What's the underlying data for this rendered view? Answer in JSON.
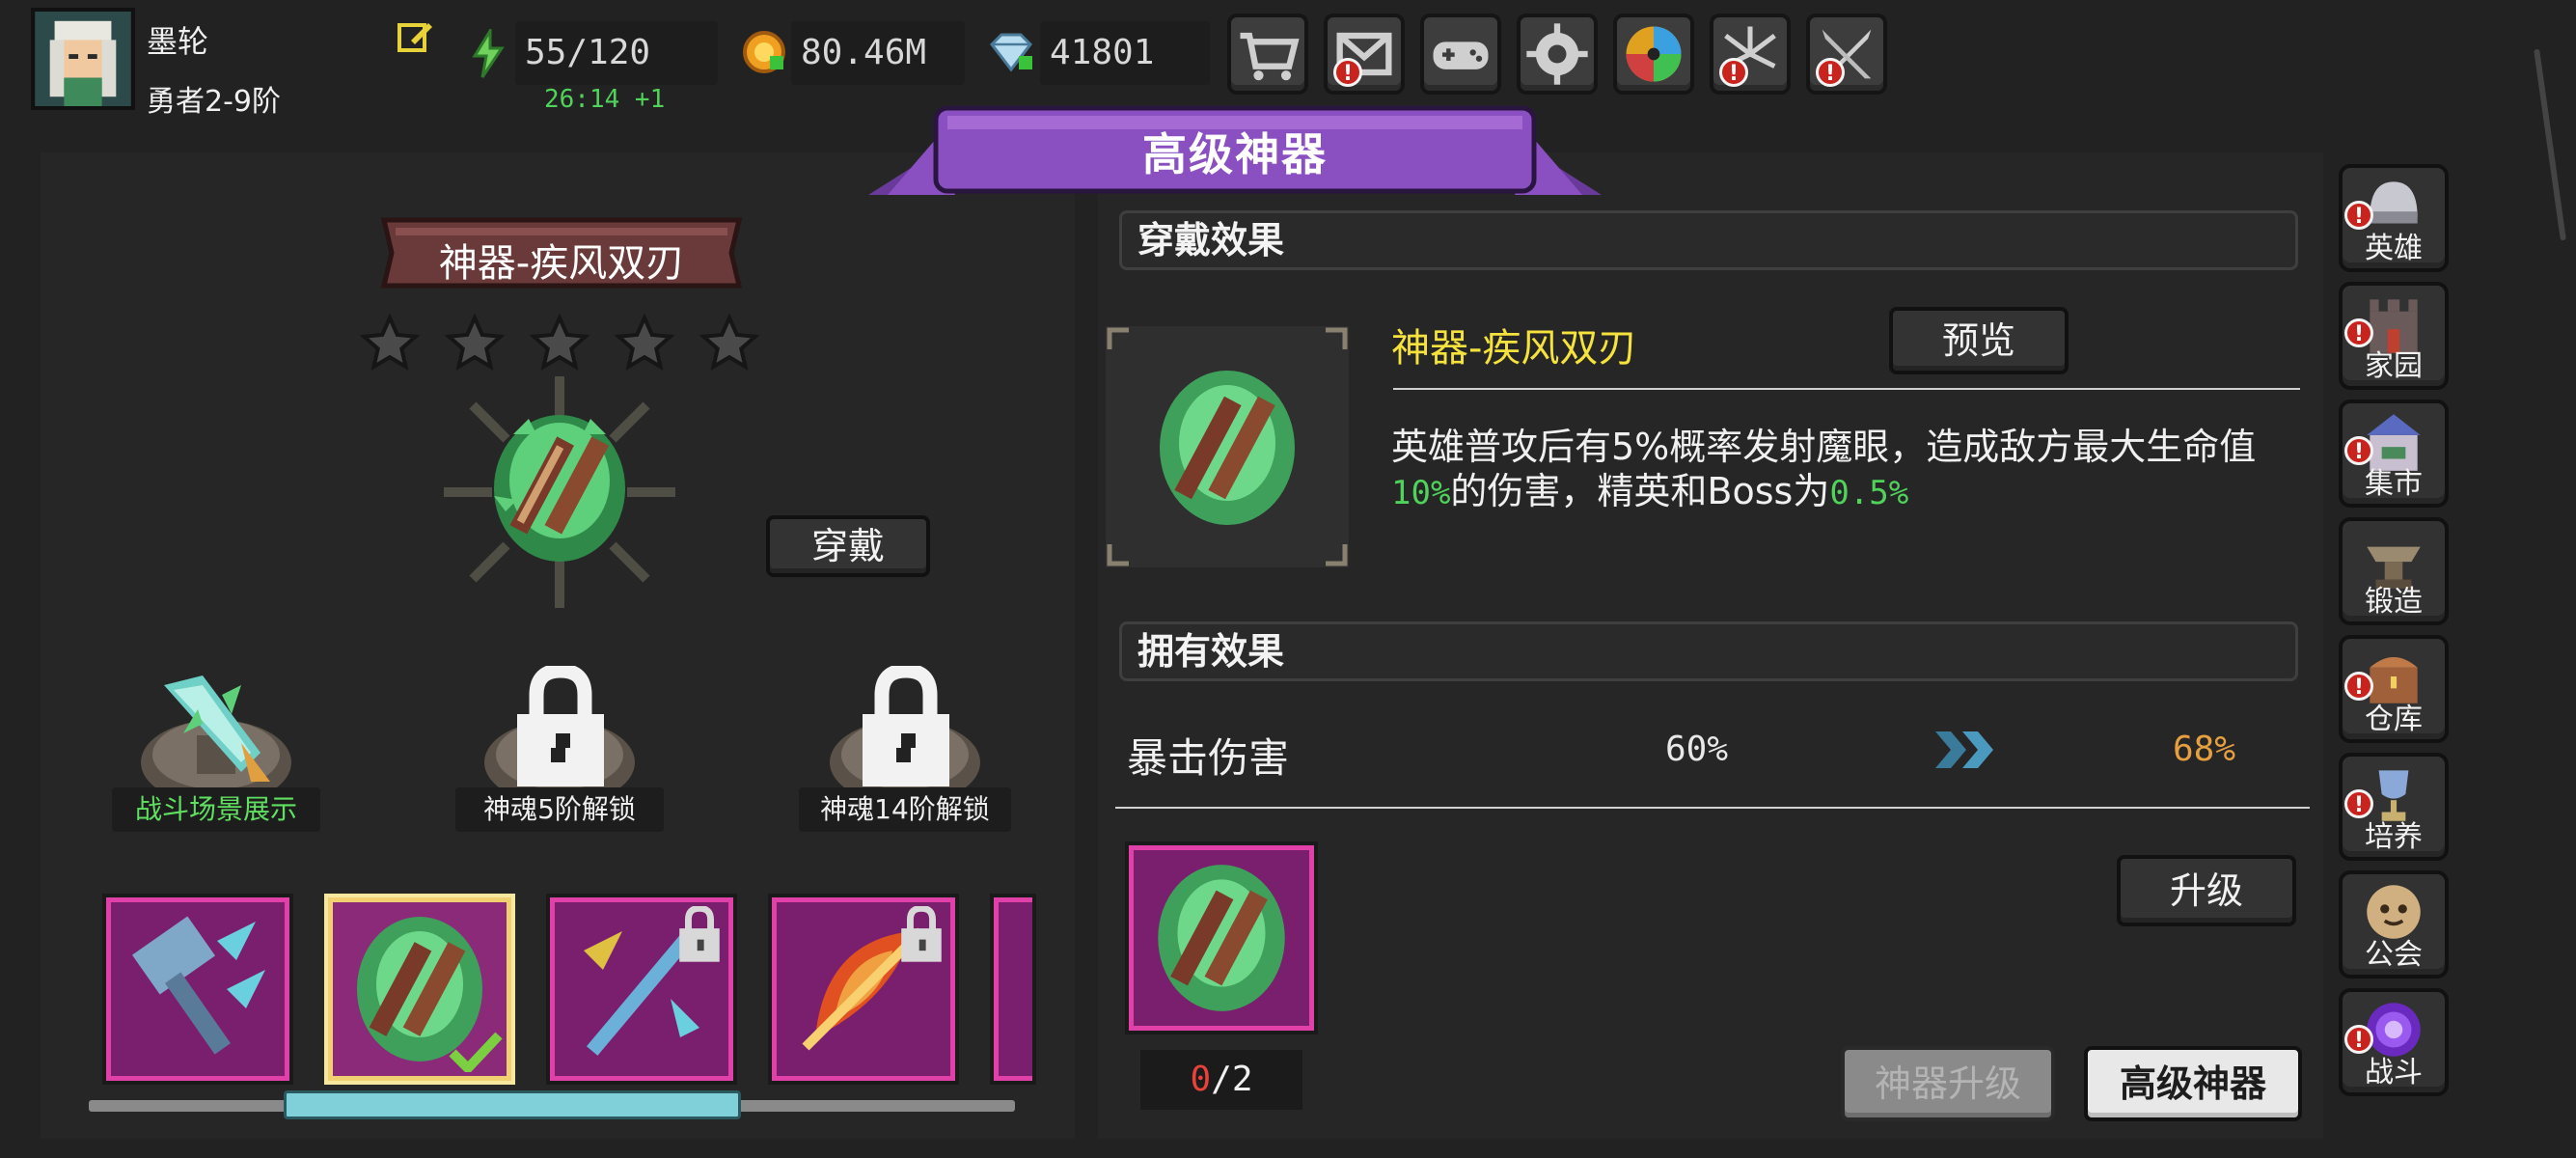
{
  "player": {
    "name": "墨轮",
    "rank": "勇者2-9阶"
  },
  "resources": {
    "energy": "55/120",
    "energy_timer": "26:14 +1",
    "gold": "80.46M",
    "gems": "41801"
  },
  "toolbar_icons": [
    "shop-icon",
    "mail-icon",
    "gamepad-icon",
    "settings-icon",
    "wheel-icon",
    "fireworks-icon",
    "sword-icon"
  ],
  "banner_title": "高级神器",
  "artifact": {
    "title": "神器-疾风双刃",
    "stars": 5,
    "equip_label": "穿戴"
  },
  "pedestals": [
    {
      "label": "战斗场景展示",
      "locked": false
    },
    {
      "label": "神魂5阶解锁",
      "locked": true
    },
    {
      "label": "神魂14阶解锁",
      "locked": true
    }
  ],
  "slots": [
    {
      "name": "hammer",
      "locked": false,
      "selected": false
    },
    {
      "name": "twin-blades",
      "locked": false,
      "selected": true
    },
    {
      "name": "trident",
      "locked": true,
      "selected": false
    },
    {
      "name": "fire-bow",
      "locked": true,
      "selected": false
    }
  ],
  "wear_effect": {
    "header": "穿戴效果",
    "name": "神器-疾风双刃",
    "preview_label": "预览",
    "desc_line1": "英雄普攻后有5%概率发射魔眼，造成敌方最大生命值",
    "desc_val1": "10%",
    "desc_mid": "的伤害，精英和Boss为",
    "desc_val2": "0.5%"
  },
  "own_effect": {
    "header": "拥有效果",
    "stat_name": "暴击伤害",
    "current": "60%",
    "next": "68%"
  },
  "upgrade": {
    "label": "升级",
    "count_have": "0",
    "count_sep": "/",
    "count_need": "2"
  },
  "bottom_buttons": {
    "upgrade_artifact": "神器升级",
    "advanced_artifact": "高级神器"
  },
  "sidebar": [
    {
      "label": "英雄",
      "icon": "helmet-icon",
      "alert": true
    },
    {
      "label": "家园",
      "icon": "castle-icon",
      "alert": true
    },
    {
      "label": "集市",
      "icon": "market-icon",
      "alert": true
    },
    {
      "label": "锻造",
      "icon": "anvil-icon",
      "alert": false
    },
    {
      "label": "仓库",
      "icon": "chest-icon",
      "alert": true
    },
    {
      "label": "培养",
      "icon": "trophy-icon",
      "alert": true
    },
    {
      "label": "公会",
      "icon": "guild-icon",
      "alert": false
    },
    {
      "label": "战斗",
      "icon": "portal-icon",
      "alert": true
    }
  ],
  "colors": {
    "accent_purple": "#8a4fc0",
    "yellow_text": "#f5e23c",
    "green_text": "#4fd35a",
    "orange_text": "#e7a040",
    "red_text": "#e8423a",
    "slot_border": "#e040a8"
  }
}
